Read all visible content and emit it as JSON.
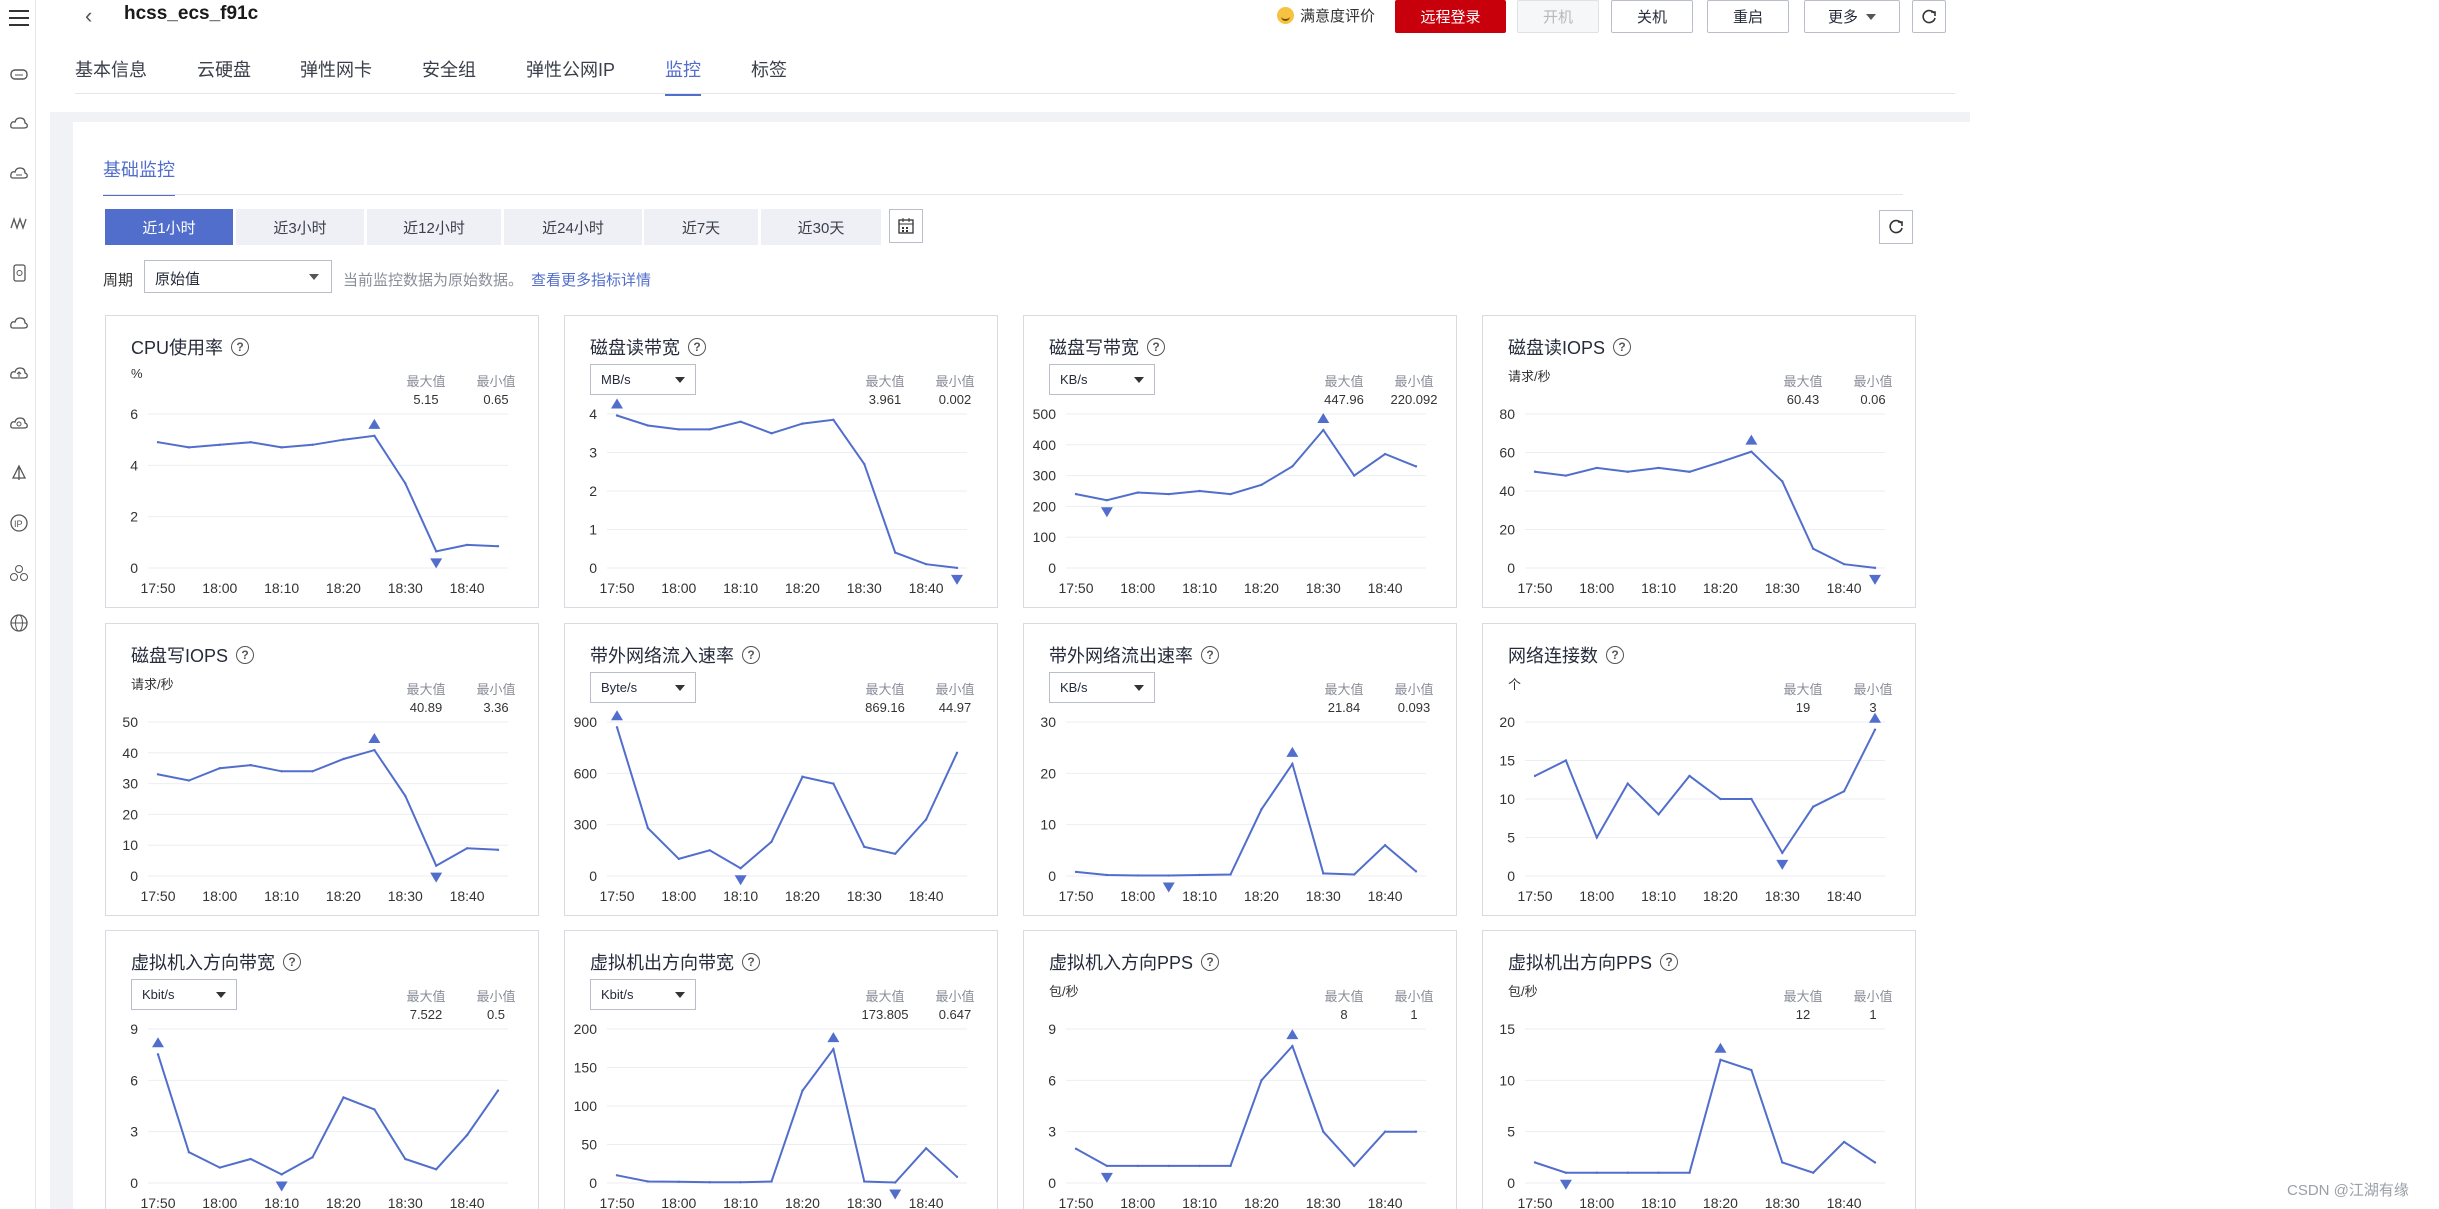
{
  "header": {
    "title": "hcss_ecs_f91c",
    "satisfaction": "满意度评价",
    "buttons": {
      "remote_login": "远程登录",
      "power_on": "开机",
      "power_off": "关机",
      "restart": "重启",
      "more": "更多"
    }
  },
  "tabs": [
    "基本信息",
    "云硬盘",
    "弹性网卡",
    "安全组",
    "弹性公网IP",
    "监控",
    "标签"
  ],
  "active_tab": "监控",
  "subtab": "基础监控",
  "ranges": [
    "近1小时",
    "近3小时",
    "近12小时",
    "近24小时",
    "近7天",
    "近30天"
  ],
  "active_range": "近1小时",
  "period": {
    "label": "周期",
    "value": "原始值",
    "note": "当前监控数据为原始数据。",
    "link": "查看更多指标详情"
  },
  "stat_labels": {
    "max": "最大值",
    "min": "最小值"
  },
  "time_ticks": [
    "17:50",
    "18:00",
    "18:10",
    "18:20",
    "18:30",
    "18:40"
  ],
  "colors": {
    "line": "#526ecc",
    "primary": "#c7000b"
  },
  "charts": [
    {
      "title": "CPU使用率",
      "unit": "%",
      "unit_select": false,
      "max": "5.15",
      "min": "0.65",
      "yticks": [
        "6",
        "4",
        "2",
        "0"
      ],
      "ymax": 6,
      "values": [
        4.9,
        4.7,
        4.8,
        4.9,
        4.7,
        4.8,
        5.0,
        5.15,
        3.3,
        0.65,
        0.9,
        0.85
      ],
      "max_idx": 7,
      "min_idx": 9
    },
    {
      "title": "磁盘读带宽",
      "unit": "MB/s",
      "unit_select": true,
      "max": "3.961",
      "min": "0.002",
      "yticks": [
        "4",
        "3",
        "2",
        "1",
        "0"
      ],
      "ymax": 4,
      "values": [
        3.961,
        3.7,
        3.6,
        3.6,
        3.8,
        3.5,
        3.75,
        3.85,
        2.7,
        0.4,
        0.1,
        0.002
      ],
      "max_idx": 0,
      "min_idx": 11
    },
    {
      "title": "磁盘写带宽",
      "unit": "KB/s",
      "unit_select": true,
      "max": "447.96",
      "min": "220.092",
      "yticks": [
        "500",
        "400",
        "300",
        "200",
        "100",
        "0"
      ],
      "ymax": 500,
      "values": [
        240,
        220.092,
        245,
        240,
        250,
        240,
        270,
        330,
        447.96,
        300,
        370,
        330
      ],
      "max_idx": 8,
      "min_idx": 1
    },
    {
      "title": "磁盘读IOPS",
      "unit": "请求/秒",
      "unit_select": false,
      "max": "60.43",
      "min": "0.06",
      "yticks": [
        "80",
        "60",
        "40",
        "20",
        "0"
      ],
      "ymax": 80,
      "values": [
        50,
        48,
        52,
        50,
        52,
        50,
        55,
        60.43,
        45,
        10,
        2,
        0.06
      ],
      "max_idx": 7,
      "min_idx": 11
    },
    {
      "title": "磁盘写IOPS",
      "unit": "请求/秒",
      "unit_select": false,
      "max": "40.89",
      "min": "3.36",
      "yticks": [
        "50",
        "40",
        "30",
        "20",
        "10",
        "0"
      ],
      "ymax": 50,
      "values": [
        33,
        31,
        35,
        36,
        34,
        34,
        38,
        40.89,
        26,
        3.36,
        9,
        8.5
      ],
      "max_idx": 7,
      "min_idx": 9
    },
    {
      "title": "带外网络流入速率",
      "unit": "Byte/s",
      "unit_select": true,
      "max": "869.16",
      "min": "44.97",
      "yticks": [
        "900",
        "600",
        "300",
        "0"
      ],
      "ymax": 900,
      "values": [
        869.16,
        280,
        100,
        150,
        44.97,
        200,
        580,
        540,
        170,
        130,
        330,
        720
      ],
      "max_idx": 0,
      "min_idx": 4
    },
    {
      "title": "带外网络流出速率",
      "unit": "KB/s",
      "unit_select": true,
      "max": "21.84",
      "min": "0.093",
      "yticks": [
        "30",
        "20",
        "10",
        "0"
      ],
      "ymax": 30,
      "values": [
        0.8,
        0.2,
        0.1,
        0.093,
        0.2,
        0.3,
        13,
        21.84,
        0.5,
        0.3,
        6,
        0.9
      ],
      "max_idx": 7,
      "min_idx": 3
    },
    {
      "title": "网络连接数",
      "unit": "个",
      "unit_select": false,
      "max": "19",
      "min": "3",
      "yticks": [
        "20",
        "15",
        "10",
        "5",
        "0"
      ],
      "ymax": 20,
      "values": [
        13,
        15,
        5,
        12,
        8,
        13,
        10,
        10,
        3,
        9,
        11,
        19
      ],
      "max_idx": 11,
      "min_idx": 8
    },
    {
      "title": "虚拟机入方向带宽",
      "unit": "Kbit/s",
      "unit_select": true,
      "max": "7.522",
      "min": "0.5",
      "yticks": [
        "9",
        "6",
        "3",
        "0"
      ],
      "ymax": 9,
      "values": [
        7.522,
        1.8,
        0.9,
        1.4,
        0.5,
        1.5,
        5,
        4.3,
        1.4,
        0.8,
        2.8,
        5.4
      ],
      "max_idx": 0,
      "min_idx": 4
    },
    {
      "title": "虚拟机出方向带宽",
      "unit": "Kbit/s",
      "unit_select": true,
      "max": "173.805",
      "min": "0.647",
      "yticks": [
        "200",
        "150",
        "100",
        "50",
        "0"
      ],
      "ymax": 200,
      "values": [
        10,
        2,
        1.5,
        1,
        1,
        2,
        120,
        173.805,
        2,
        0.647,
        45,
        8
      ],
      "max_idx": 7,
      "min_idx": 9
    },
    {
      "title": "虚拟机入方向PPS",
      "unit": "包/秒",
      "unit_select": false,
      "max": "8",
      "min": "1",
      "yticks": [
        "9",
        "6",
        "3",
        "0"
      ],
      "ymax": 9,
      "values": [
        2,
        1,
        1,
        1,
        1,
        1,
        6,
        8,
        3,
        1,
        3,
        3
      ],
      "max_idx": 7,
      "min_idx": 1
    },
    {
      "title": "虚拟机出方向PPS",
      "unit": "包/秒",
      "unit_select": false,
      "max": "12",
      "min": "1",
      "yticks": [
        "15",
        "10",
        "5",
        "0"
      ],
      "ymax": 15,
      "values": [
        2,
        1,
        1,
        1,
        1,
        1,
        12,
        11,
        2,
        1,
        4,
        2
      ],
      "max_idx": 6,
      "min_idx": 1
    }
  ],
  "watermark": "CSDN @江湖有缘"
}
